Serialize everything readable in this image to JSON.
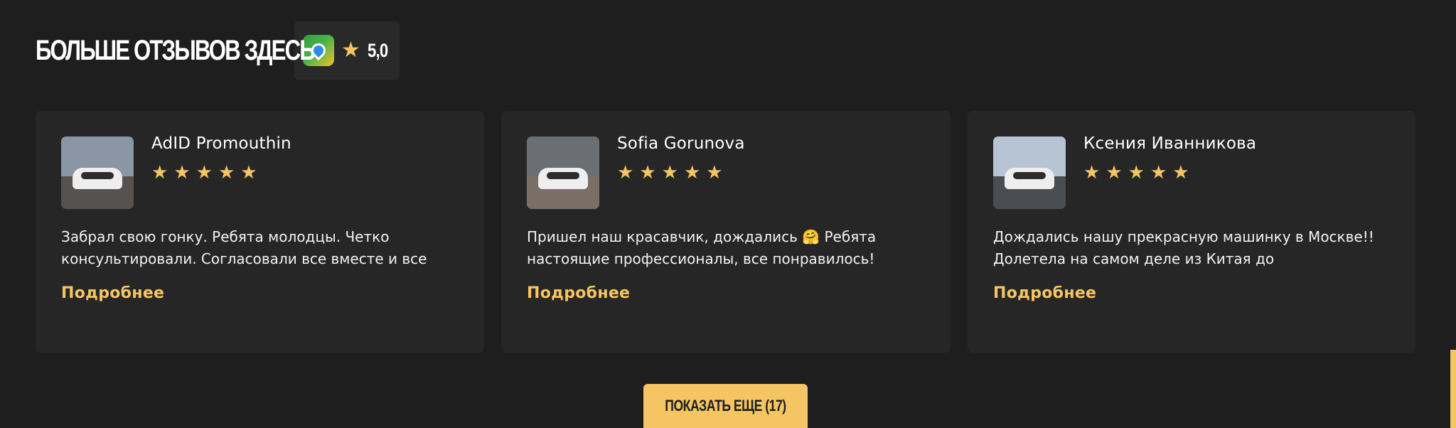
{
  "header": {
    "title": "БОЛЬШЕ ОТЗЫВОВ ЗДЕСЬ",
    "logo_icon": "yandex-maps-icon",
    "rating": "5,0"
  },
  "reviews": [
    {
      "name": "AdID Promouthin",
      "stars": 5,
      "text": "Забрал свою гонку. Ребята молодцы. Четко консультировали. Согласовали все вместе и все",
      "more": "Подробнее",
      "avatar_colors": {
        "sky": "#8a96a3",
        "ground": "#55524f"
      }
    },
    {
      "name": "Sofia Gorunova",
      "stars": 5,
      "text": "Пришел наш красавчик, дождались 🤗 Ребята настоящие профессионалы, все понравилось!",
      "more": "Подробнее",
      "avatar_colors": {
        "sky": "#6b6e73",
        "ground": "#7a6f66"
      }
    },
    {
      "name": "Ксения Иванникова",
      "stars": 5,
      "text": "Дождались нашу прекрасную машинку в Москве!! Долетела на самом деле из Китая до",
      "more": "Подробнее",
      "avatar_colors": {
        "sky": "#b7c4d3",
        "ground": "#4a4d52"
      }
    }
  ],
  "show_more_label": "ПОКАЗАТЬ ЕЩЕ (17)",
  "colors": {
    "background": "#1e1e1f",
    "card": "#262627",
    "accent": "#f4c562"
  }
}
